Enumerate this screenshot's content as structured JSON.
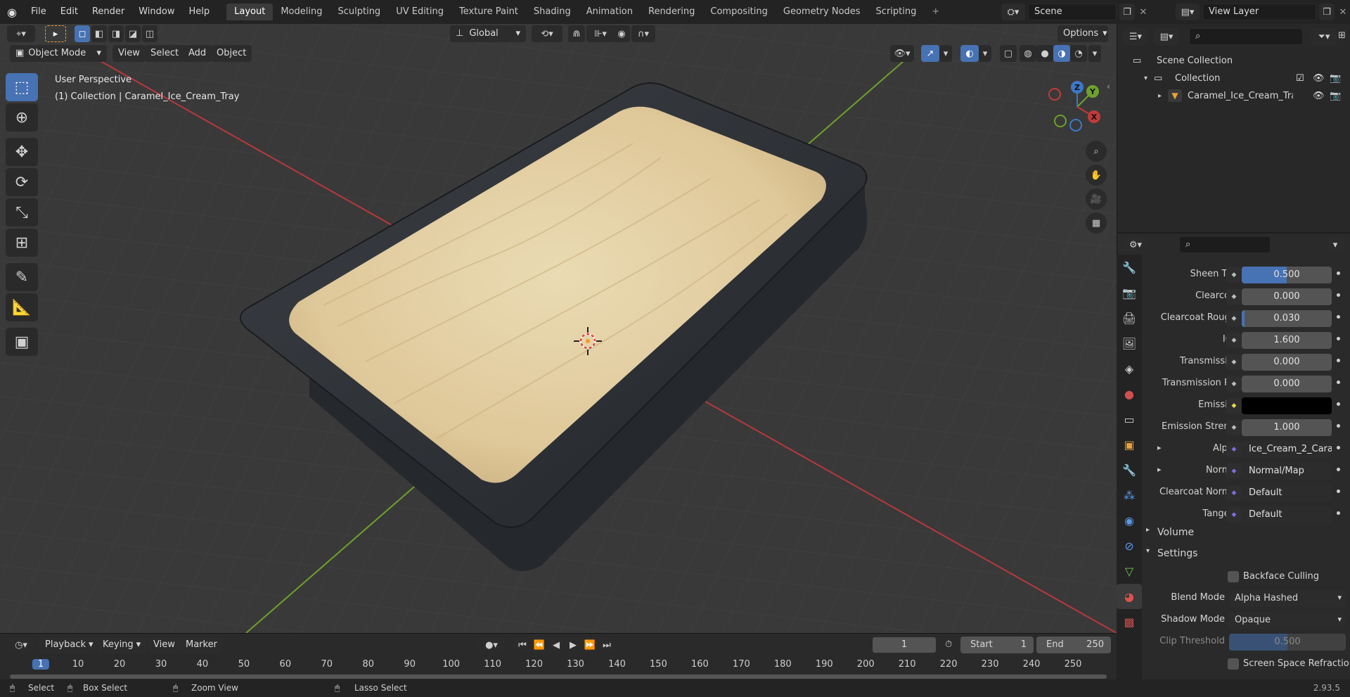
{
  "topbar": {
    "menu": [
      "File",
      "Edit",
      "Render",
      "Window",
      "Help"
    ],
    "workspaces": [
      "Layout",
      "Modeling",
      "Sculpting",
      "UV Editing",
      "Texture Paint",
      "Shading",
      "Animation",
      "Rendering",
      "Compositing",
      "Geometry Nodes",
      "Scripting"
    ],
    "active_workspace": "Layout",
    "add_tab": "+",
    "scene": "Scene",
    "view_layer": "View Layer"
  },
  "viewport_header": {
    "mode": "Object Mode",
    "menus": [
      "View",
      "Select",
      "Add",
      "Object"
    ],
    "orientation": "Global",
    "options": "Options"
  },
  "viewport": {
    "overlay_line1": "User Perspective",
    "overlay_line2": "(1) Collection | Caramel_Ice_Cream_Tray",
    "gizmo": {
      "x": "X",
      "y": "Y",
      "z": "Z"
    },
    "colors": {
      "background": "#393939",
      "x_axis": "#c23a3a",
      "y_axis": "#6ea12c",
      "ice_cream": "#e3cfa3",
      "tray": "#2e3136"
    }
  },
  "toolbar": {
    "tools": [
      {
        "name": "select-box-tool-icon",
        "glyph": "⬚",
        "active": true
      },
      {
        "name": "cursor-tool-icon",
        "glyph": "⊕",
        "active": false
      },
      {
        "name": "move-tool-icon",
        "glyph": "✥",
        "active": false
      },
      {
        "name": "rotate-tool-icon",
        "glyph": "⟳",
        "active": false
      },
      {
        "name": "scale-tool-icon",
        "glyph": "⤡",
        "active": false
      },
      {
        "name": "transform-tool-icon",
        "glyph": "⊞",
        "active": false
      },
      {
        "name": "annotate-tool-icon",
        "glyph": "✎",
        "active": false
      },
      {
        "name": "measure-tool-icon",
        "glyph": "📐",
        "active": false
      },
      {
        "name": "add-cube-tool-icon",
        "glyph": "▣",
        "active": false
      }
    ]
  },
  "outliner": {
    "rows": [
      {
        "label": "Scene Collection"
      },
      {
        "label": "Collection"
      },
      {
        "label": "Caramel_Ice_Cream_Tray"
      }
    ]
  },
  "properties": {
    "rows": [
      {
        "label": "Sheen Tint",
        "value": "0.500",
        "fill": 0.5
      },
      {
        "label": "Clearcoat",
        "value": "0.000",
        "fill": 0
      },
      {
        "label": "Clearcoat Roug...",
        "value": "0.030",
        "fill": 0.03
      },
      {
        "label": "IOR",
        "value": "1.600",
        "fill": 0
      },
      {
        "label": "Transmission",
        "value": "0.000",
        "fill": 0
      },
      {
        "label": "Transmission R...",
        "value": "0.000",
        "fill": 0
      },
      {
        "label": "Emission",
        "value": "",
        "fill": 0,
        "color": "#000000"
      },
      {
        "label": "Emission Strengt",
        "value": "1.000",
        "fill": 0
      },
      {
        "label": "Alpha",
        "value": "Ice_Cream_2_Cara...",
        "link": true,
        "expand": "▸"
      },
      {
        "label": "Normal",
        "value": "Normal/Map",
        "link": true,
        "expand": "▸"
      },
      {
        "label": "Clearcoat Normal",
        "value": "Default",
        "link": true
      },
      {
        "label": "Tangent",
        "value": "Default",
        "link": true
      }
    ],
    "volume_panel": "Volume",
    "settings_panel": "Settings",
    "backface_culling": "Backface Culling",
    "blend_mode_label": "Blend Mode",
    "blend_mode_value": "Alpha Hashed",
    "shadow_mode_label": "Shadow Mode",
    "shadow_mode_value": "Opaque",
    "clip_threshold_label": "Clip Threshold",
    "clip_threshold_value": "0.500",
    "ssr_label": "Screen Space Refraction"
  },
  "timeline": {
    "menus": [
      "Playback",
      "Keying",
      "View",
      "Marker"
    ],
    "current_frame": "1",
    "start_label": "Start",
    "start_value": "1",
    "end_label": "End",
    "end_value": "250",
    "ruler": [
      "1",
      "10",
      "20",
      "30",
      "40",
      "50",
      "60",
      "70",
      "80",
      "90",
      "100",
      "110",
      "120",
      "130",
      "140",
      "150",
      "160",
      "170",
      "180",
      "190",
      "200",
      "210",
      "220",
      "230",
      "240",
      "250"
    ]
  },
  "statusbar": {
    "select": "Select",
    "box_select": "Box Select",
    "zoom_view": "Zoom View",
    "lasso_select": "Lasso Select",
    "version": "2.93.5"
  }
}
